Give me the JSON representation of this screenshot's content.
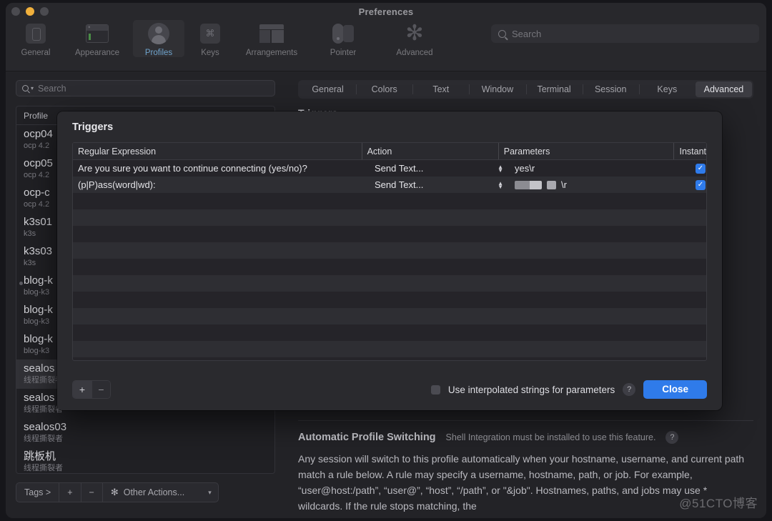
{
  "window": {
    "title": "Preferences"
  },
  "toolbar": {
    "items": [
      {
        "label": "General",
        "icon": "general-icon"
      },
      {
        "label": "Appearance",
        "icon": "appearance-icon"
      },
      {
        "label": "Profiles",
        "icon": "profiles-icon"
      },
      {
        "label": "Keys",
        "icon": "keys-icon"
      },
      {
        "label": "Arrangements",
        "icon": "arrangements-icon"
      },
      {
        "label": "Pointer",
        "icon": "pointer-icon"
      },
      {
        "label": "Advanced",
        "icon": "advanced-gear-icon"
      }
    ],
    "selected": "Profiles",
    "search_placeholder": "Search"
  },
  "sidebar": {
    "search_placeholder": "Search",
    "column_header": "Profile",
    "profiles": [
      {
        "name": "ocp04",
        "sub": "ocp 4.2"
      },
      {
        "name": "ocp05",
        "sub": "ocp 4.2"
      },
      {
        "name": "ocp-c",
        "sub": "ocp 4.2"
      },
      {
        "name": "k3s01",
        "sub": "k3s"
      },
      {
        "name": "k3s03",
        "sub": "k3s"
      },
      {
        "name": "blog-k",
        "sub": "blog-k3"
      },
      {
        "name": "blog-k",
        "sub": "blog-k3"
      },
      {
        "name": "blog-k",
        "sub": "blog-k3"
      },
      {
        "name": "sealos",
        "sub": "线程撕裂者"
      },
      {
        "name": "sealos",
        "sub": "线程撕裂者"
      },
      {
        "name": "sealos03",
        "sub": "线程撕裂者"
      },
      {
        "name": "跳板机",
        "sub": "线程撕裂者"
      }
    ],
    "footer": {
      "tags_label": "Tags >",
      "add_label": "+",
      "remove_label": "−",
      "other_actions_label": "Other Actions...",
      "gear_icon": "gear-icon",
      "caret_icon": "chevron-down-icon"
    }
  },
  "pane": {
    "tabs": [
      "General",
      "Colors",
      "Text",
      "Window",
      "Terminal",
      "Session",
      "Keys",
      "Advanced"
    ],
    "selected_tab": "Advanced",
    "section_title": "Triggers",
    "auto_profile": {
      "title": "Automatic Profile Switching",
      "note": "Shell Integration must be installed to use this feature.",
      "help_icon": "help-icon",
      "body": "Any session will switch to this profile automatically when your hostname, username, and current path match a rule below. A rule may specify a username, hostname, path, or job. For example, “user@host:/path”, “user@”, “host”, “/path”, or \"&job\". Hostnames, paths, and jobs may use * wildcards. If the rule stops matching, the"
    }
  },
  "dialog": {
    "title": "Triggers",
    "columns": [
      "Regular Expression",
      "Action",
      "Parameters",
      "Instant"
    ],
    "rows": [
      {
        "regex": "Are you sure you want to continue connecting (yes/no)?",
        "action": "Send Text...",
        "parameter": "yes\\r",
        "redacted": false,
        "instant": true
      },
      {
        "regex": "(p|P)ass(word|wd):",
        "action": "Send Text...",
        "parameter": "\\r",
        "redacted": true,
        "instant": true
      }
    ],
    "empty_row_count": 10,
    "add_label": "+",
    "remove_label": "−",
    "interpolate_label": "Use interpolated strings for parameters",
    "interpolate_checked": false,
    "help_icon": "help-icon",
    "close_label": "Close"
  },
  "watermark": "@51CTO博客",
  "colors": {
    "accent": "#2f7bea",
    "selected_tab_text": "#6fa3cc",
    "window_bg": "#242428",
    "dialog_bg": "#2a2a2e"
  }
}
